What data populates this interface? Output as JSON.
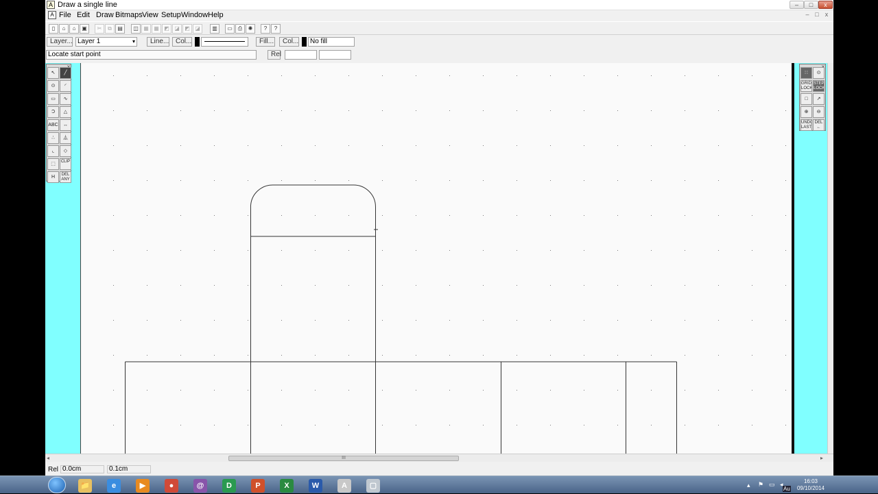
{
  "window": {
    "title": "Draw a single line",
    "app_icon": "A",
    "min_label": "–",
    "max_label": "□",
    "close_label": "x"
  },
  "menubar": {
    "items": [
      "File",
      "Edit",
      "Draw",
      "Bitmaps",
      "View",
      "Setup",
      "Window",
      "Help"
    ],
    "mdi_min": "–",
    "mdi_restore": "□",
    "mdi_close": "x"
  },
  "properties": {
    "layer_button": "Layer...",
    "layer_value": "Layer 1",
    "line_button": "Line...",
    "line_colour_button": "Col...",
    "fill_button": "Fill...",
    "fill_colour_button": "Col...",
    "fill_value": "No fill",
    "line_colour": "#000000",
    "fill_colour": "#000000"
  },
  "prompt": {
    "text": "Locate start point",
    "rel_button": "Rel",
    "coord_x": "",
    "coord_y": ""
  },
  "left_palette": {
    "tools": [
      {
        "name": "pointer-tool",
        "glyph": "↖"
      },
      {
        "name": "line-tool",
        "glyph": "╱",
        "active": true
      },
      {
        "name": "circle-tool",
        "glyph": "⊙"
      },
      {
        "name": "arc-tool",
        "glyph": "◜"
      },
      {
        "name": "rectangle-tool",
        "glyph": "▭"
      },
      {
        "name": "curve-tool",
        "glyph": "∿"
      },
      {
        "name": "spiral-tool",
        "glyph": "Ɔ"
      },
      {
        "name": "polygon-tool",
        "glyph": "△"
      },
      {
        "name": "text-tool",
        "glyph": "ABC"
      },
      {
        "name": "dimension-tool",
        "glyph": "↔"
      },
      {
        "name": "points-tool",
        "glyph": "∴"
      },
      {
        "name": "symbol-tool",
        "glyph": "⏅"
      },
      {
        "name": "fillet-tool",
        "glyph": "⌞"
      },
      {
        "name": "erase-tool",
        "glyph": "◇"
      },
      {
        "name": "select-box-tool",
        "glyph": "⬚"
      },
      {
        "name": "clip-tool",
        "glyph": "CLIP"
      },
      {
        "name": "hatch-tool",
        "glyph": "H"
      },
      {
        "name": "delete-any-tool",
        "glyph": "DEL ANY"
      }
    ]
  },
  "right_palette": {
    "tools": [
      {
        "name": "grid-tool",
        "glyph": "∷",
        "dark": true
      },
      {
        "name": "snap-tool",
        "glyph": "⊙"
      },
      {
        "name": "grid-lock-tool",
        "glyph": "GRID LOCK"
      },
      {
        "name": "step-lock-tool",
        "glyph": "STEP LOCK",
        "dark": true
      },
      {
        "name": "window-zoom-tool",
        "glyph": "□"
      },
      {
        "name": "pan-tool",
        "glyph": "↗"
      },
      {
        "name": "zoom-in-tool",
        "glyph": "⊕"
      },
      {
        "name": "zoom-out-tool",
        "glyph": "⊖"
      },
      {
        "name": "undo-last-tool",
        "glyph": "UNDO LAST"
      },
      {
        "name": "delete-last-tool",
        "glyph": "DEL ←"
      }
    ]
  },
  "status": {
    "rel_label": "Rel",
    "x_value": "0.0cm",
    "y_value": "0.1cm"
  },
  "hscroll": {
    "grip": "III",
    "left_arrow": "◂",
    "right_arrow": "▸"
  },
  "taskbar": {
    "apps": [
      {
        "name": "explorer-icon",
        "glyph": "📁",
        "color": "#e8c060"
      },
      {
        "name": "ie-icon",
        "glyph": "e",
        "color": "#3a8de0"
      },
      {
        "name": "media-player-icon",
        "glyph": "▶",
        "color": "#e88a20"
      },
      {
        "name": "chrome-icon",
        "glyph": "●",
        "color": "#d04a38"
      },
      {
        "name": "app-swirl-icon",
        "glyph": "@",
        "color": "#8855aa"
      },
      {
        "name": "app-green-icon",
        "glyph": "D",
        "color": "#2a9a50"
      },
      {
        "name": "powerpoint-icon",
        "glyph": "P",
        "color": "#d0502a"
      },
      {
        "name": "excel-icon",
        "glyph": "X",
        "color": "#2a8a40"
      },
      {
        "name": "word-icon",
        "glyph": "W",
        "color": "#2a5aaa"
      },
      {
        "name": "draw-app-icon",
        "glyph": "A",
        "color": "#c8c8c8"
      },
      {
        "name": "window-app-icon",
        "glyph": "▢",
        "color": "#c0c8d0"
      }
    ],
    "tray_lang": "Au",
    "clock_time": "16:03",
    "clock_date": "09/10/2014"
  }
}
